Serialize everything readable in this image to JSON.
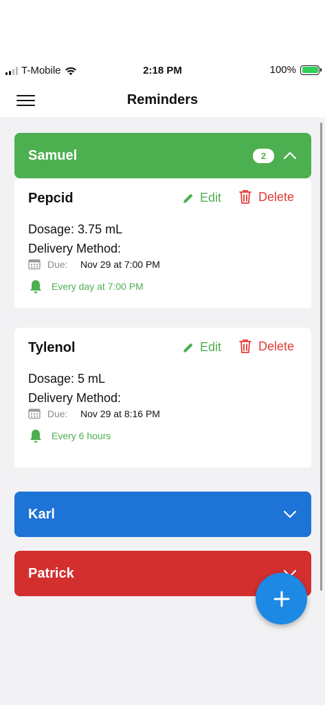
{
  "status_bar": {
    "carrier": "T-Mobile",
    "time": "2:18 PM",
    "battery": "100%"
  },
  "header": {
    "title": "Reminders"
  },
  "colors": {
    "green": "#4caf50",
    "blue": "#1e73d6",
    "red": "#d32f2f",
    "fab": "#1e88e5",
    "delete": "#e53935"
  },
  "groups": [
    {
      "name": "Samuel",
      "count": "2",
      "expanded": true,
      "reminders": [
        {
          "name": "Pepcid",
          "edit_label": "Edit",
          "delete_label": "Delete",
          "dosage": "Dosage: 3.75 mL",
          "method": "Delivery Method:",
          "due_label": "Due:",
          "due_value": "Nov 29 at 7:00 PM",
          "repeat": "Every day at 7:00 PM"
        },
        {
          "name": "Tylenol",
          "edit_label": "Edit",
          "delete_label": "Delete",
          "dosage": "Dosage: 5 mL",
          "method": "Delivery Method:",
          "due_label": "Due:",
          "due_value": "Nov 29 at 8:16 PM",
          "repeat": "Every 6 hours"
        }
      ]
    },
    {
      "name": "Karl",
      "expanded": false
    },
    {
      "name": "Patrick",
      "expanded": false
    }
  ],
  "icons": {
    "menu": "hamburger-icon",
    "edit": "pencil-icon",
    "delete": "trash-icon",
    "due": "calendar-icon",
    "repeat": "bell-icon",
    "add": "plus-icon"
  }
}
